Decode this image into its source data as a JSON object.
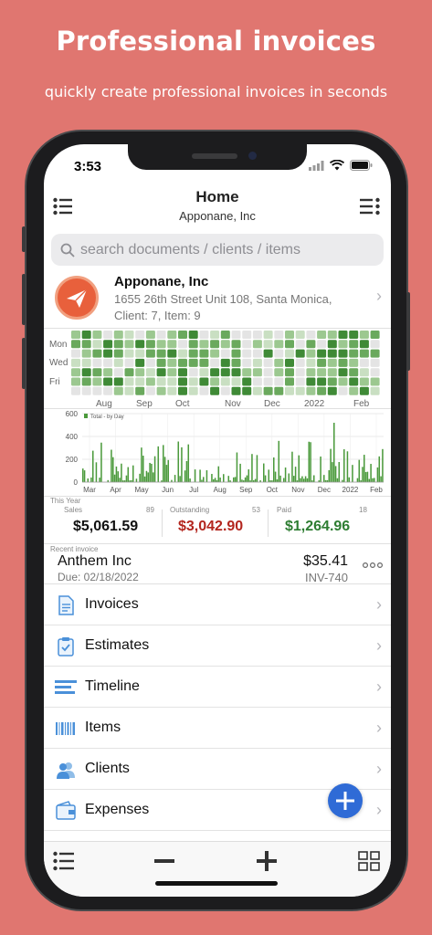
{
  "hero": {
    "title": "Professional invoices",
    "subtitle": "quickly create professional invoices in seconds"
  },
  "status_bar": {
    "time": "3:53"
  },
  "nav": {
    "title": "Home",
    "subtitle": "Apponane, Inc"
  },
  "search": {
    "placeholder": "search documents / clients / items"
  },
  "company": {
    "name": "Apponane, Inc",
    "address": "1655 26th Street Unit 108, Santa Monica,",
    "stats": "Client: 7,  Item: 9"
  },
  "heatmap": {
    "row_labels": [
      "Mon",
      "Wed",
      "Fri"
    ],
    "months": [
      "Aug",
      "Sep",
      "Oct",
      "Nov",
      "Dec",
      "2022",
      "Feb"
    ]
  },
  "chart_data": {
    "type": "bar",
    "legend": "Total - by Day",
    "y_ticks": [
      "600",
      "400",
      "200",
      "0"
    ],
    "ylim": [
      0,
      600
    ],
    "x_ticks": [
      "Mar",
      "Apr",
      "May",
      "Jun",
      "Jul",
      "Aug",
      "Sep",
      "Oct",
      "Nov",
      "Dec",
      "2022",
      "Feb"
    ],
    "color": "#4b9a3c"
  },
  "summary": {
    "period": "This Year",
    "sales": {
      "label": "Sales",
      "count": "89",
      "value": "$5,061.59"
    },
    "outstanding": {
      "label": "Outstanding",
      "count": "53",
      "value": "$3,042.90",
      "color": "#b3261e"
    },
    "paid": {
      "label": "Paid",
      "count": "18",
      "value": "$1,264.96",
      "color": "#2e7d32"
    }
  },
  "recent": {
    "label": "Recent invoice",
    "client": "Anthem Inc",
    "due": "Due: 02/18/2022",
    "amount": "$35.41",
    "number": "INV-740"
  },
  "menu": [
    {
      "label": "Invoices",
      "icon": "invoice-icon"
    },
    {
      "label": "Estimates",
      "icon": "clipboard-check-icon"
    },
    {
      "label": "Timeline",
      "icon": "timeline-icon"
    },
    {
      "label": "Items",
      "icon": "barcode-icon"
    },
    {
      "label": "Clients",
      "icon": "clients-icon"
    },
    {
      "label": "Expenses",
      "icon": "wallet-icon"
    }
  ],
  "colors": {
    "accent": "#2f6bd6",
    "background": "#e07670",
    "icon_blue": "#4a90d9"
  }
}
